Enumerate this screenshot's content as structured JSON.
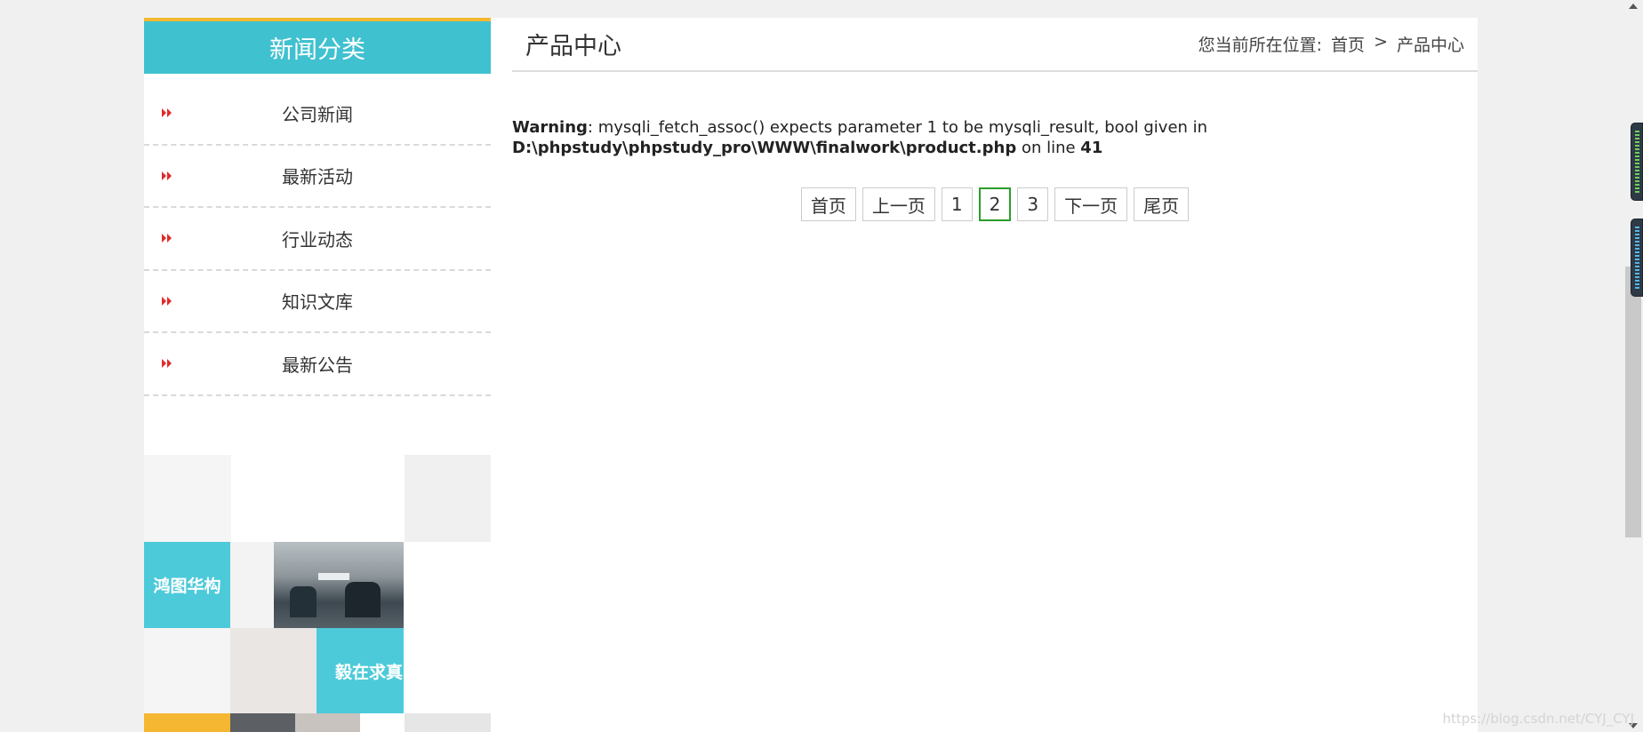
{
  "sidebar": {
    "title": "新闻分类",
    "items": [
      {
        "label": "公司新闻"
      },
      {
        "label": "最新活动"
      },
      {
        "label": "行业动态"
      },
      {
        "label": "知识文库"
      },
      {
        "label": "最新公告"
      }
    ],
    "tiles": {
      "tile_a": "鸿图华构",
      "tile_b": "毅在求真"
    }
  },
  "main": {
    "title": "产品中心",
    "breadcrumb": {
      "prefix": "您当前所在位置:",
      "home": "首页",
      "separator": ">",
      "current": "产品中心"
    },
    "warning": {
      "label": "Warning",
      "message": ": mysqli_fetch_assoc() expects parameter 1 to be mysqli_result, bool given in",
      "path": "D:\\phpstudy\\phpstudy_pro\\WWW\\finalwork\\product.php",
      "on_line": " on line ",
      "line": "41"
    },
    "pager": {
      "first": "首页",
      "prev": "上一页",
      "pages": [
        "1",
        "2",
        "3"
      ],
      "current_page": "2",
      "next": "下一页",
      "last": "尾页"
    }
  },
  "watermark": "https://blog.csdn.net/CYJ_CYJ",
  "colors": {
    "accent": "#40c1d0",
    "top_border": "#f5b731",
    "arrow": "#e02b2b",
    "active_page": "#2a9d2a"
  }
}
